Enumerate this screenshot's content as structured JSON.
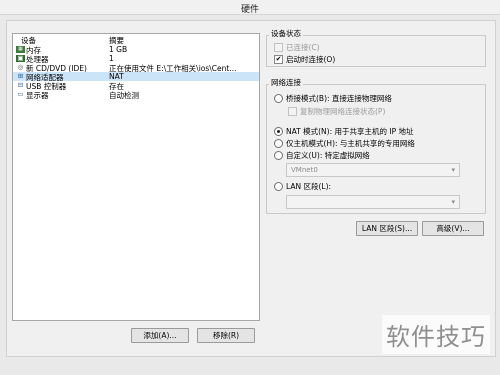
{
  "window": {
    "title": "硬件"
  },
  "device_list": {
    "columns": [
      "设备",
      "摘要"
    ],
    "rows": [
      {
        "icon": "memory-icon",
        "name": "内存",
        "summary": "1 GB",
        "selected": false
      },
      {
        "icon": "processor-icon",
        "name": "处理器",
        "summary": "1",
        "selected": false
      },
      {
        "icon": "cd-dvd-icon",
        "name": "新 CD/DVD (IDE)",
        "summary": "正在使用文件 E:\\工作相关\\ios\\Cent...",
        "selected": false
      },
      {
        "icon": "network-adapter-icon",
        "name": "网络适配器",
        "summary": "NAT",
        "selected": true
      },
      {
        "icon": "usb-icon",
        "name": "USB 控制器",
        "summary": "存在",
        "selected": false
      },
      {
        "icon": "display-icon",
        "name": "显示器",
        "summary": "自动检测",
        "selected": false
      }
    ]
  },
  "buttons": {
    "add": "添加(A)...",
    "remove": "移除(R)",
    "lan_segments": "LAN 区段(S)...",
    "advanced": "高级(V)..."
  },
  "device_status": {
    "label": "设备状态",
    "connected": {
      "label": "已连接(C)",
      "checked": false,
      "enabled": false
    },
    "connect_at_power_on": {
      "label": "启动时连接(O)",
      "checked": true,
      "enabled": true
    }
  },
  "network": {
    "label": "网络连接",
    "bridged": {
      "label": "桥接模式(B): 直接连接物理网络",
      "selected": false
    },
    "replicate": {
      "label": "复制物理网络连接状态(P)",
      "checked": false,
      "enabled": false
    },
    "nat": {
      "label": "NAT 模式(N): 用于共享主机的 IP 地址",
      "selected": true
    },
    "host_only": {
      "label": "仅主机模式(H): 与主机共享的专用网络",
      "selected": false
    },
    "custom": {
      "label": "自定义(U): 特定虚拟网络",
      "selected": false
    },
    "vmnet_value": "VMnet0",
    "lan_segment": {
      "label": "LAN 区段(L):",
      "selected": false
    },
    "lan_value": ""
  },
  "watermark": "软件技巧"
}
